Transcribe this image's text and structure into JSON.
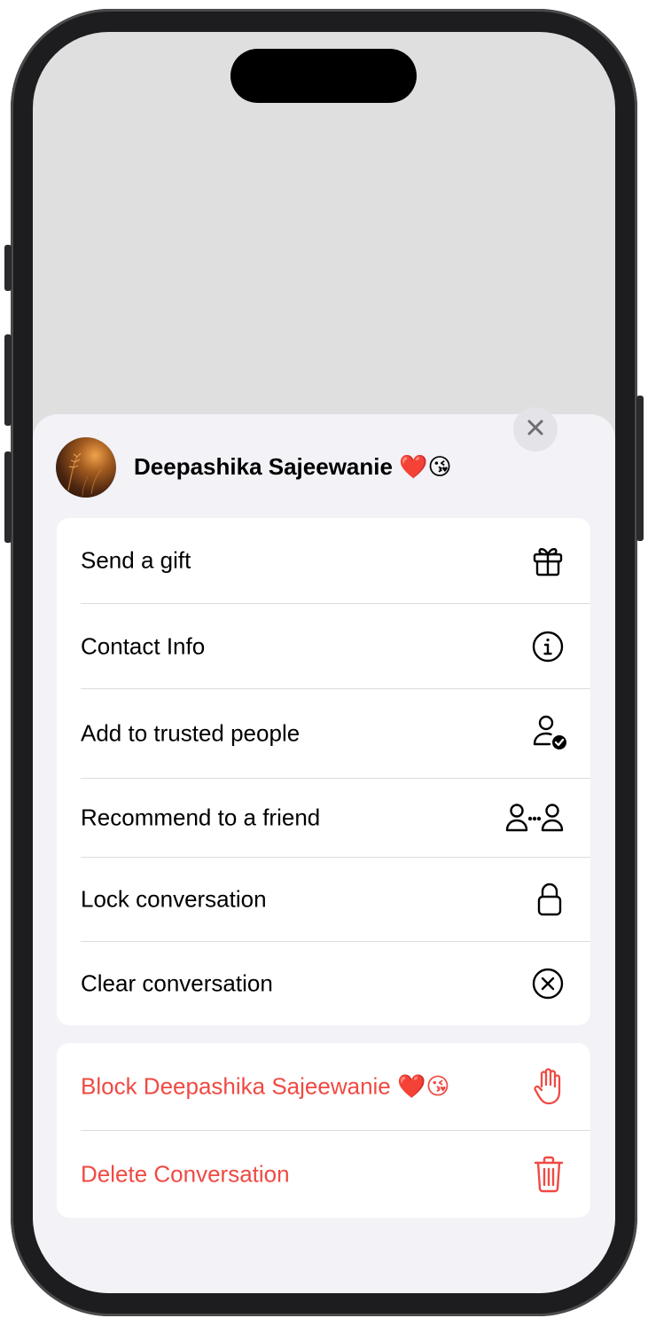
{
  "contact": {
    "name": "Deepashika Sajeewanie ❤️😘"
  },
  "menu": {
    "items": [
      {
        "label": "Send a gift",
        "icon": "gift-icon"
      },
      {
        "label": "Contact Info",
        "icon": "info-circle-icon"
      },
      {
        "label": "Add to trusted people",
        "icon": "person-shield-icon"
      },
      {
        "label": "Recommend to a friend",
        "icon": "people-share-icon"
      },
      {
        "label": "Lock conversation",
        "icon": "lock-icon"
      },
      {
        "label": "Clear conversation",
        "icon": "x-circle-icon"
      }
    ]
  },
  "danger_menu": {
    "items": [
      {
        "label": "Block Deepashika Sajeewanie ❤️😘",
        "icon": "raised-hand-icon"
      },
      {
        "label": "Delete Conversation",
        "icon": "trash-icon"
      }
    ]
  },
  "colors": {
    "danger": "#ef4a43",
    "sheet_background": "#f2f2f7",
    "group_background": "#ffffff"
  }
}
